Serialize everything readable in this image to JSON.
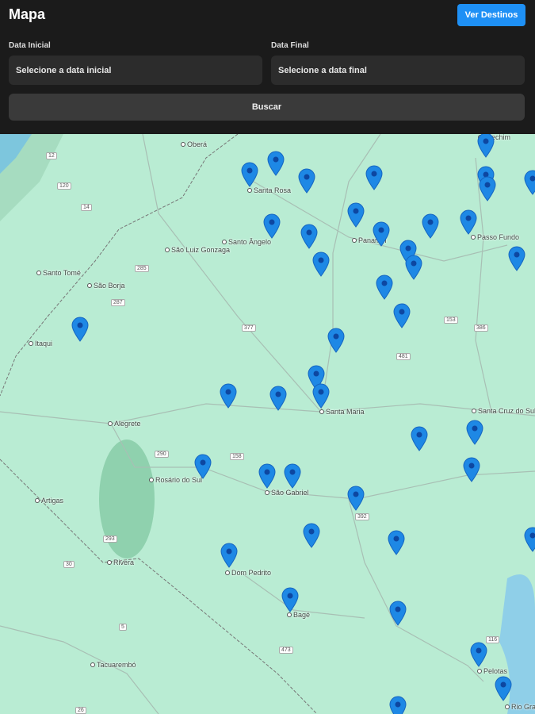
{
  "header": {
    "title": "Mapa",
    "ver_destinos": "Ver Destinos"
  },
  "form": {
    "start_label": "Data Inicial",
    "start_placeholder": "Selecione a data inicial",
    "end_label": "Data Final",
    "end_placeholder": "Selecione a data final",
    "search_label": "Buscar"
  },
  "map": {
    "cities": [
      "Oberá",
      "Santa Rosa",
      "Erechim",
      "Santo Ângelo",
      "São Luiz Gonzaga",
      "Passo Fundo",
      "Santo Tomé",
      "São Borja",
      "Itaqui",
      "Santa Maria",
      "Santa Cruz do Sul",
      "Alegrete",
      "Rosário do Sul",
      "São Gabriel",
      "Artigas",
      "Rivera",
      "Dom Pedrito",
      "Bagé",
      "Tacuarembó",
      "Pelotas",
      "Rio Grande",
      "Panambi"
    ],
    "roads": [
      "12",
      "120",
      "14",
      "285",
      "287",
      "377",
      "158",
      "481",
      "153",
      "386",
      "290",
      "293",
      "392",
      "116",
      "473",
      "5",
      "30",
      "26"
    ],
    "marker_color": "#1e88e5"
  }
}
